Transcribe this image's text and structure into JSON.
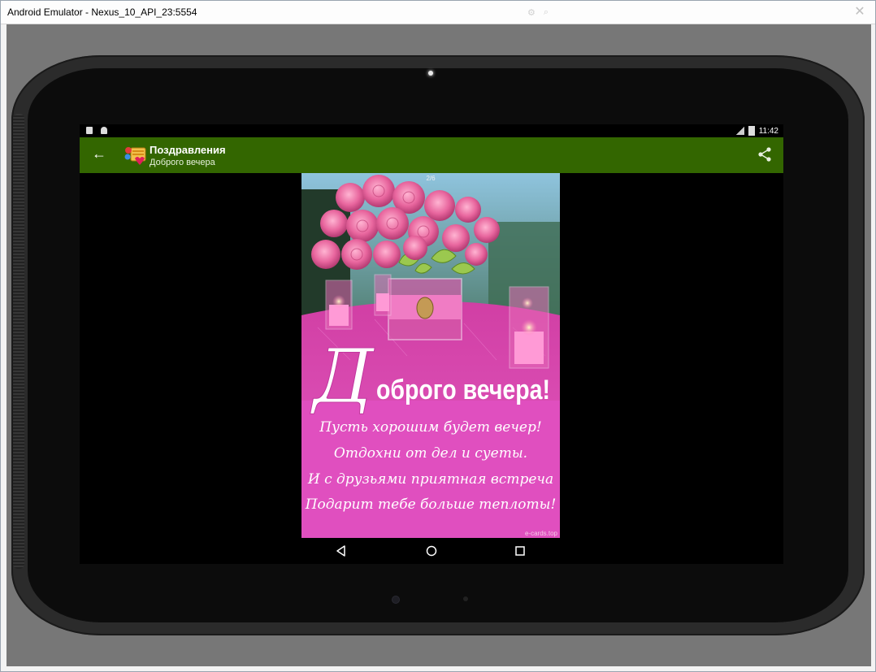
{
  "window": {
    "title": "Android Emulator - Nexus_10_API_23:5554",
    "close_glyph": "✕"
  },
  "statusbar": {
    "time": "11:42"
  },
  "appbar": {
    "title": "Поздравления",
    "subtitle": "Доброго вечера",
    "back_glyph": "←"
  },
  "card": {
    "page_counter": "2/6",
    "heading_initial": "Д",
    "heading_rest": "оброго вечера!",
    "poem": [
      "Пусть хорошим будет вечер!",
      "Отдохни от дел и суеты.",
      "И с друзьями приятная встреча",
      "Подарит тебе больше теплоты!"
    ],
    "credit": "e-cards.top"
  },
  "colors": {
    "appbar": "#336600",
    "card_pink": "#e04fbf",
    "rose": "#e8669e"
  },
  "icons": [
    "back-arrow-icon",
    "app-logo-icon",
    "share-icon",
    "nav-back-icon",
    "nav-home-icon",
    "nav-recents-icon"
  ]
}
